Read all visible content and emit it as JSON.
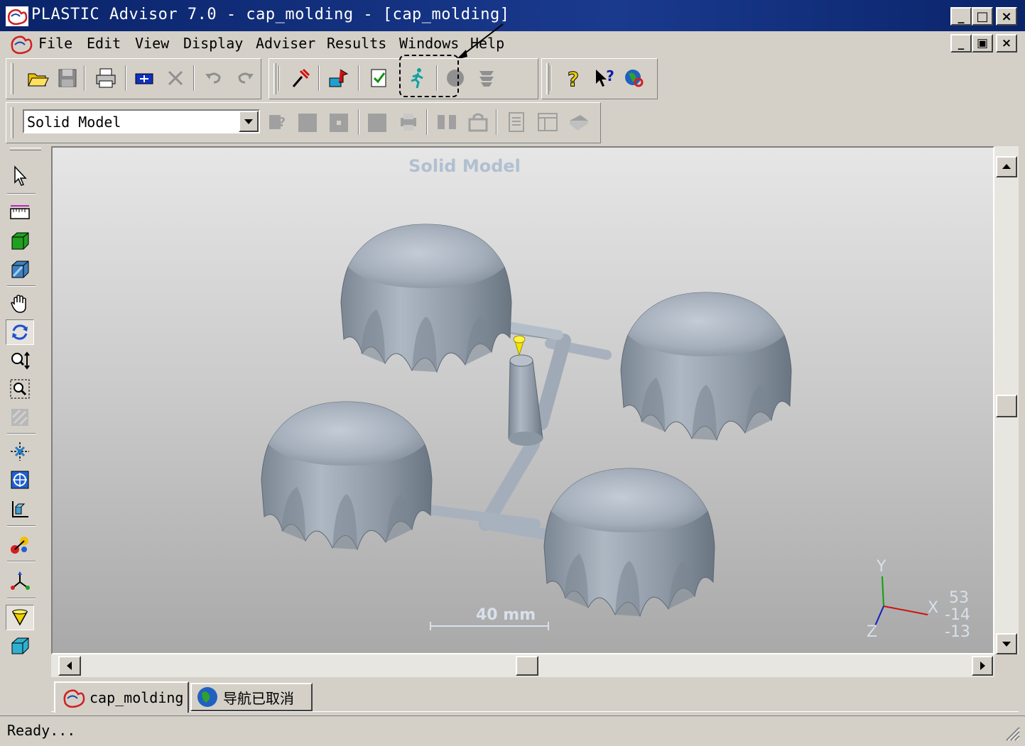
{
  "window": {
    "title": "PLASTIC Advisor 7.0 - cap_molding - [cap_molding]",
    "minimize": "_",
    "maximize": "□",
    "close": "×"
  },
  "menu": {
    "items": [
      "File",
      "Edit",
      "View",
      "Display",
      "Adviser",
      "Results",
      "Windows",
      "Help"
    ]
  },
  "toolbar1": {
    "buttons": [
      "open-icon",
      "save-icon",
      "print-icon",
      "send-icon",
      "delete-icon",
      "undo-icon",
      "redo-icon",
      "pick-icon",
      "gate-location-icon",
      "check-icon",
      "run-analysis-icon",
      "stop-icon",
      "queue-icon",
      "help-icon",
      "context-help-icon",
      "web-help-icon"
    ]
  },
  "toolbar2": {
    "display_mode": "Solid Model"
  },
  "viewport": {
    "label": "Solid Model",
    "scale_label": "40 mm",
    "axis_y": "Y",
    "axis_x": "X",
    "axis_z": "Z",
    "view_angles": [
      "53",
      "-14",
      "-13"
    ]
  },
  "tabs": [
    {
      "label": "cap_molding",
      "active": true
    },
    {
      "label": "导航已取消",
      "active": false
    }
  ],
  "status": {
    "text": "Ready..."
  },
  "colors": {
    "titlebar": "#0a246a",
    "face": "#d4d0c8",
    "part": "#9aa6b4",
    "gate": "#f2e400",
    "axis_x": "#d01010",
    "axis_y": "#10a010",
    "axis_z": "#1020c0"
  }
}
